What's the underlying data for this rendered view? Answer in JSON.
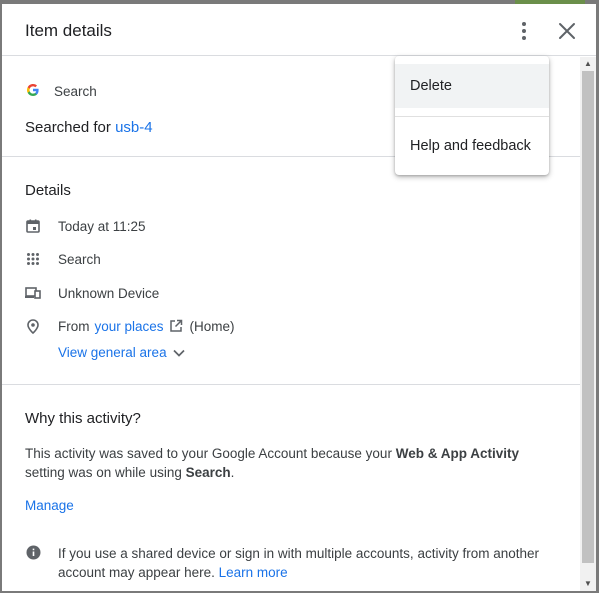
{
  "dialog": {
    "title": "Item details",
    "more_icon": "more-vert-icon",
    "close_icon": "close-icon"
  },
  "item": {
    "product": "Search",
    "product_icon": "google-g-icon",
    "searched_prefix": "Searched for",
    "query": "usb-4"
  },
  "details": {
    "heading": "Details",
    "time": "Today at 11:25",
    "time_icon": "calendar-icon",
    "source": "Search",
    "source_icon": "apps-grid-icon",
    "device": "Unknown Device",
    "device_icon": "devices-icon",
    "location_prefix": "From",
    "location_link": "your places",
    "location_suffix": "(Home)",
    "location_icon": "location-pin-icon",
    "external_icon": "open-in-new-icon",
    "view_area": "View general area",
    "view_area_icon": "chevron-down-icon"
  },
  "why": {
    "heading": "Why this activity?",
    "text_1": "This activity was saved to your Google Account because your",
    "bold_1": "Web & App Activity",
    "text_2": "setting was on while using",
    "bold_2": "Search",
    "text_3": ".",
    "manage": "Manage",
    "note_icon": "info-icon",
    "note": "If you use a shared device or sign in with multiple accounts, activity from another account may appear here.",
    "learn_more": "Learn more"
  },
  "menu": {
    "items": [
      {
        "label": "Delete",
        "highlighted": true
      },
      {
        "label": "Help and feedback",
        "highlighted": false
      }
    ]
  },
  "colors": {
    "link": "#1a73e8",
    "text": "#202124",
    "secondary_text": "#3c4043",
    "icon": "#5f6368",
    "divider": "#dadce0"
  }
}
